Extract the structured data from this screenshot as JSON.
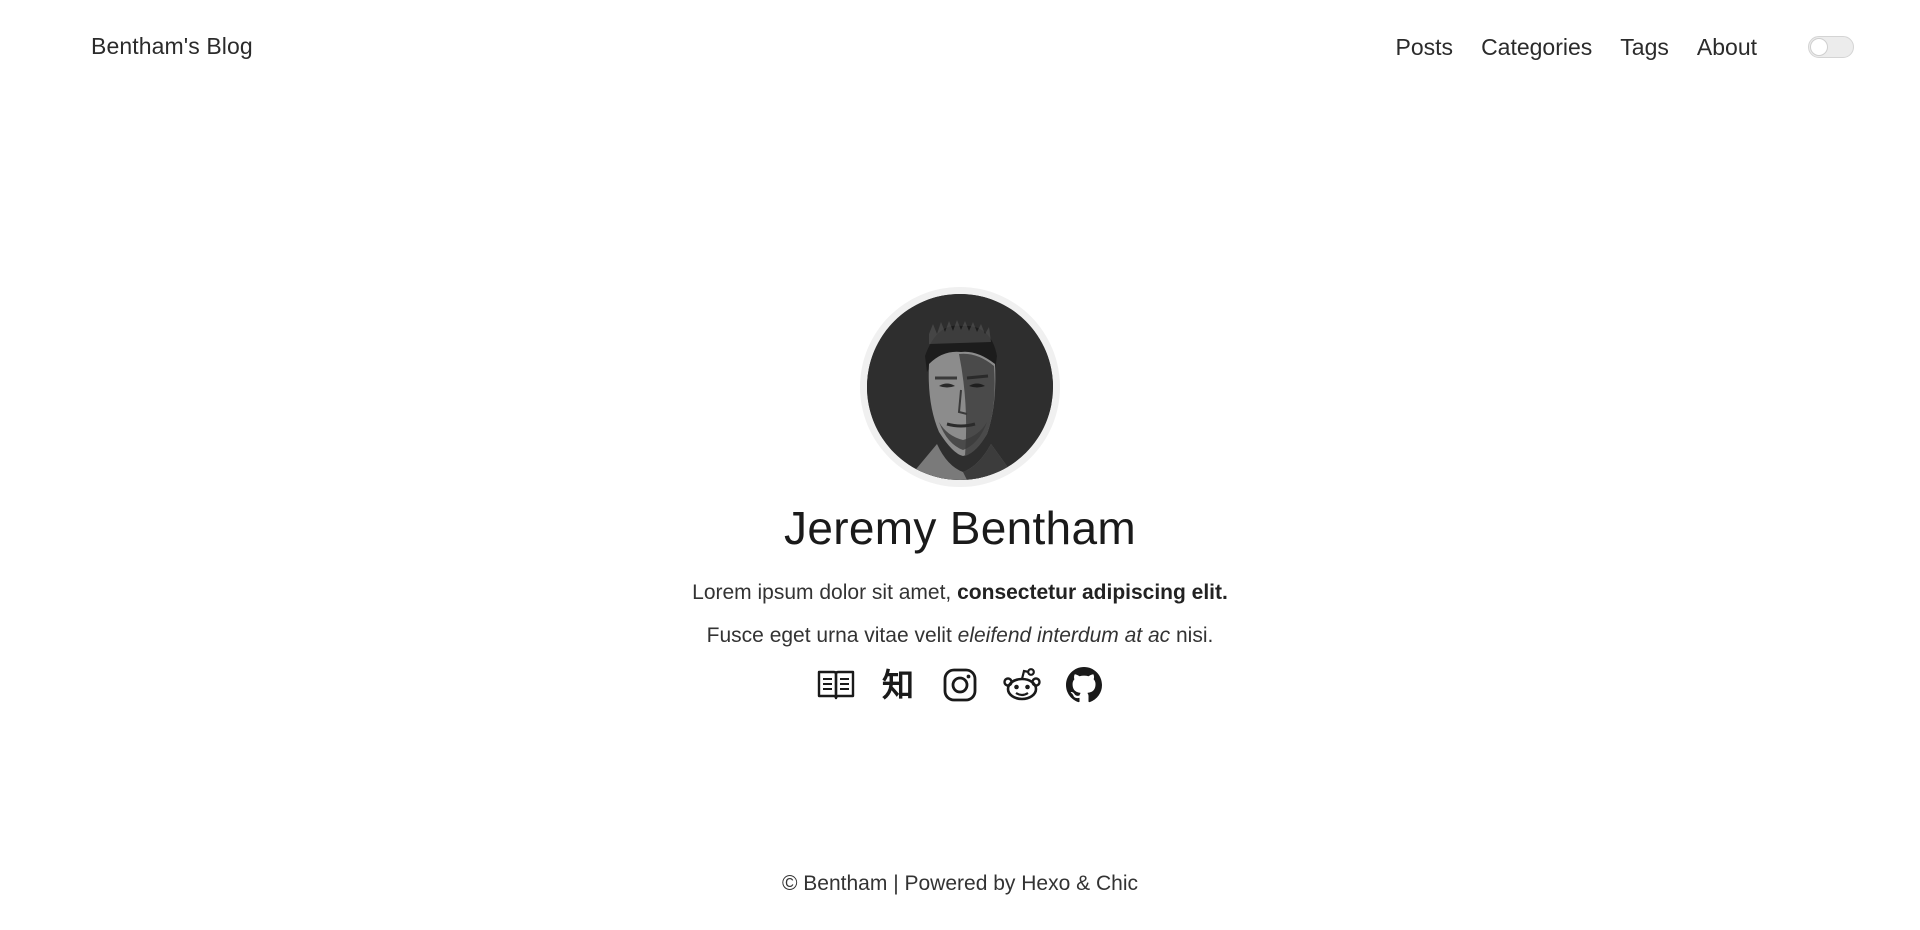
{
  "header": {
    "blog_title": "Bentham's Blog",
    "nav": [
      {
        "label": "Posts"
      },
      {
        "label": "Categories"
      },
      {
        "label": "Tags"
      },
      {
        "label": "About"
      }
    ],
    "theme_toggle": {
      "icon": "toggle-switch-icon",
      "state": "off"
    }
  },
  "profile": {
    "avatar_alt": "portrait",
    "name": "Jeremy Bentham",
    "bio_line1_plain": "Lorem ipsum dolor sit amet,",
    "bio_line1_bold": "consectetur adipiscing elit.",
    "bio_line2_plain": "Fusce eget urna vitae velit",
    "bio_line2_italic": "eleifend interdum at ac",
    "bio_line2_end": "nisi.",
    "social": [
      {
        "icon": "book-icon"
      },
      {
        "icon": "zhihu-icon",
        "glyph": "知"
      },
      {
        "icon": "instagram-icon"
      },
      {
        "icon": "reddit-icon"
      },
      {
        "icon": "github-icon"
      }
    ]
  },
  "footer": {
    "copyright": "© Bentham",
    "separator": "|",
    "powered_by": "Powered by",
    "hexo": "Hexo",
    "amp": "&",
    "chic": "Chic"
  },
  "colors": {
    "background": "#ffffff",
    "text": "#222222",
    "avatar_ring": "#f0f0f0"
  }
}
